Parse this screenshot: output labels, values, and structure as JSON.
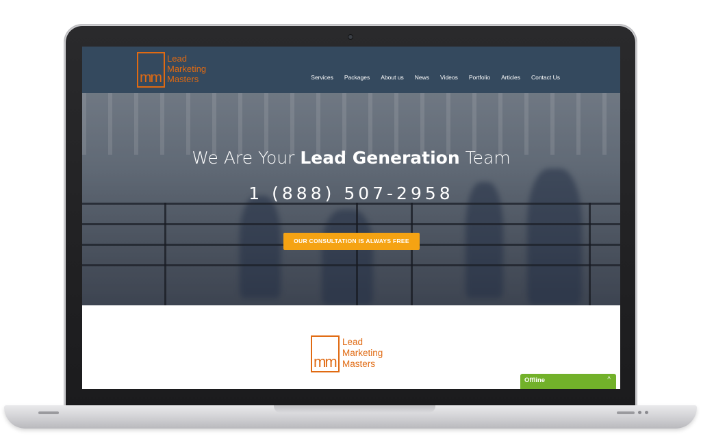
{
  "navbar": {
    "logo": {
      "mark": "mm",
      "lines": [
        "Lead",
        "Marketing",
        "Masters"
      ]
    },
    "links": [
      "Services",
      "Packages",
      "About us",
      "News",
      "Videos",
      "Portfolio",
      "Articles",
      "Contact Us"
    ]
  },
  "hero": {
    "title_pre": "We Are Your",
    "title_bold": "Lead Generation",
    "title_post": "Team",
    "phone": "1 (888) 507-2958",
    "cta_label": "OUR CONSULTATION IS ALWAYS FREE"
  },
  "section": {
    "logo": {
      "mark": "mm",
      "lines": [
        "Lead",
        "Marketing",
        "Masters"
      ]
    }
  },
  "chat": {
    "status": "Offline",
    "chevron": "^"
  },
  "colors": {
    "navbar": "#34495e",
    "brand_orange": "#e06a12",
    "cta": "#f5a313",
    "chat": "#72b12a"
  }
}
